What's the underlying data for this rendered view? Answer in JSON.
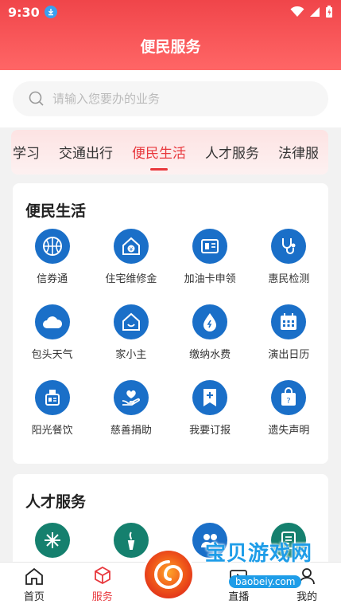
{
  "status": {
    "time": "9:30"
  },
  "header": {
    "title": "便民服务"
  },
  "search": {
    "placeholder": "请输入您要办的业务"
  },
  "tabs": [
    {
      "label": "学习"
    },
    {
      "label": "交通出行"
    },
    {
      "label": "便民生活",
      "active": true
    },
    {
      "label": "人才服务"
    },
    {
      "label": "法律服"
    }
  ],
  "section1": {
    "title": "便民生活",
    "items": [
      {
        "label": "信券通",
        "icon": "basketball-icon"
      },
      {
        "label": "住宅维修金",
        "icon": "house-yen-icon"
      },
      {
        "label": "加油卡申领",
        "icon": "fuel-card-icon"
      },
      {
        "label": "惠民检测",
        "icon": "stethoscope-icon"
      },
      {
        "label": "包头天气",
        "icon": "cloud-icon"
      },
      {
        "label": "家小主",
        "icon": "home-smile-icon"
      },
      {
        "label": "缴纳水费",
        "icon": "water-drop-icon"
      },
      {
        "label": "演出日历",
        "icon": "calendar-icon"
      },
      {
        "label": "阳光餐饮",
        "icon": "food-icon"
      },
      {
        "label": "慈善捐助",
        "icon": "heart-hand-icon"
      },
      {
        "label": "我要订报",
        "icon": "bookmark-plus-icon"
      },
      {
        "label": "遗失声明",
        "icon": "bag-question-icon"
      }
    ]
  },
  "section2": {
    "title": "人才服务",
    "items": [
      {
        "icon": "compass-icon"
      },
      {
        "icon": "torch-icon"
      },
      {
        "icon": "people-icon"
      },
      {
        "icon": "notebook-icon"
      }
    ]
  },
  "bottom_nav": [
    {
      "label": "首页",
      "icon": "home-icon"
    },
    {
      "label": "服务",
      "icon": "cube-icon",
      "active": true
    },
    {
      "label": "",
      "icon": "center-logo-icon"
    },
    {
      "label": "直播",
      "icon": "live-icon"
    },
    {
      "label": "我的",
      "icon": "user-icon"
    }
  ],
  "watermark": {
    "text": "宝贝游戏网",
    "url": "baobeiy.com"
  },
  "colors": {
    "accent": "#e8383d",
    "icon_blue": "#1a6fc8",
    "icon_green": "#15806e"
  }
}
